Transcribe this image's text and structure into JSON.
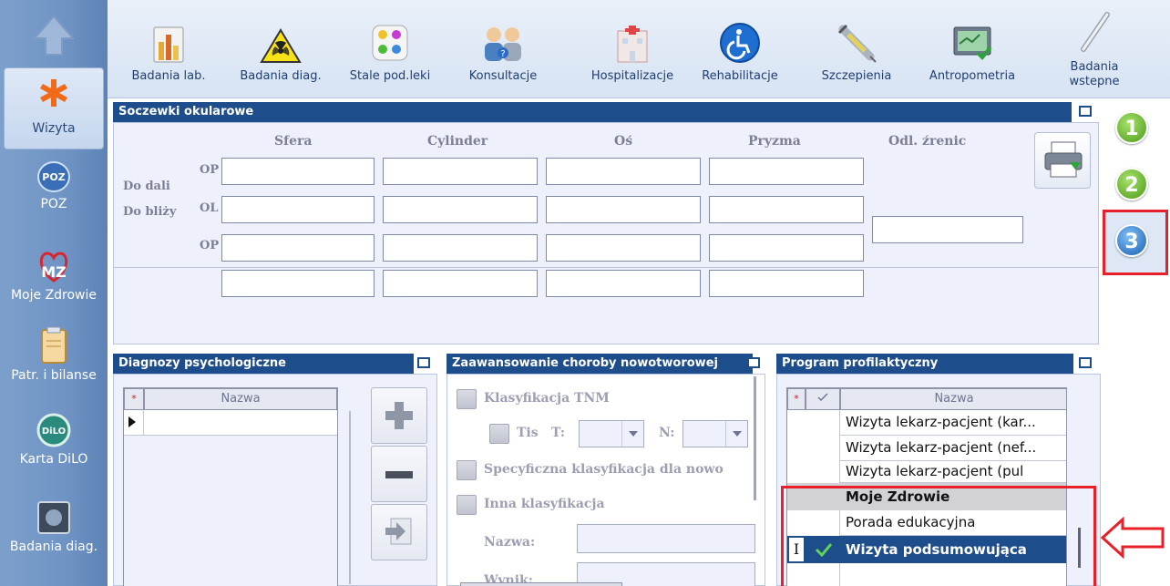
{
  "sidebar": {
    "items": [
      {
        "label": "Wizyta",
        "icon": "caduceus-star-icon"
      },
      {
        "label": "POZ",
        "icon": "poz-icon"
      },
      {
        "label": "Moje Zdrowie",
        "icon": "heart-mz-icon"
      },
      {
        "label": "Patr. i bilanse",
        "icon": "clipboard-icon"
      },
      {
        "label": "Karta DiLO",
        "icon": "dilo-icon"
      },
      {
        "label": "Badania diag.",
        "icon": "scan-icon"
      }
    ]
  },
  "toolbar": {
    "items": [
      {
        "label": "Badania lab.",
        "icon": "lab-chart-icon"
      },
      {
        "label": "Badania diag.",
        "icon": "radiation-icon"
      },
      {
        "label": "Stale pod.leki",
        "icon": "pills-icon"
      },
      {
        "label": "Konsultacje",
        "icon": "consultation-icon"
      },
      {
        "label": "Hospitalizacje",
        "icon": "hospital-icon"
      },
      {
        "label": "Rehabilitacje",
        "icon": "wheelchair-icon"
      },
      {
        "label": "Szczepienia",
        "icon": "syringe-icon"
      },
      {
        "label": "Antropometria",
        "icon": "monitor-check-icon"
      },
      {
        "label_line1": "Badania",
        "label_line2": "wstepne",
        "icon": "thermometer-icon"
      }
    ]
  },
  "lenses": {
    "title": "Soczewki okularowe",
    "columns": [
      "Sfera",
      "Cylinder",
      "Oś",
      "Pryzma",
      "Odl. źrenic"
    ],
    "group_far": "Do dali",
    "group_near": "Do bliży",
    "op": "OP",
    "ol": "OL"
  },
  "psych": {
    "title": "Diagnozy psychologiczne",
    "col_name": "Nazwa",
    "star": "*"
  },
  "cancer": {
    "title": "Zaawansowanie choroby nowotworowej",
    "tnm": "Klasyfikacja TNM",
    "tis": "Tis",
    "t": "T:",
    "n": "N:",
    "specific": "Specyficzna klasyfikacja dla nowo",
    "other": "Inna klasyfikacja",
    "name_label": "Nazwa:",
    "result_label": "Wynik:"
  },
  "program": {
    "title": "Program profilaktyczny",
    "col_name": "Nazwa",
    "rows": [
      "Wizyta lekarz-pacjent (kar...",
      "Wizyta lekarz-pacjent (nef...",
      "Wizyta lekarz-pacjent (pul",
      "Moje Zdrowie",
      "Porada edukacyjna",
      "Wizyta podsumowująca"
    ]
  },
  "steps": [
    "1",
    "2",
    "3"
  ],
  "colors": {
    "title_bar": "#1e4d8b",
    "highlight": "#e8202a",
    "selected_row": "#1e4d8b"
  }
}
